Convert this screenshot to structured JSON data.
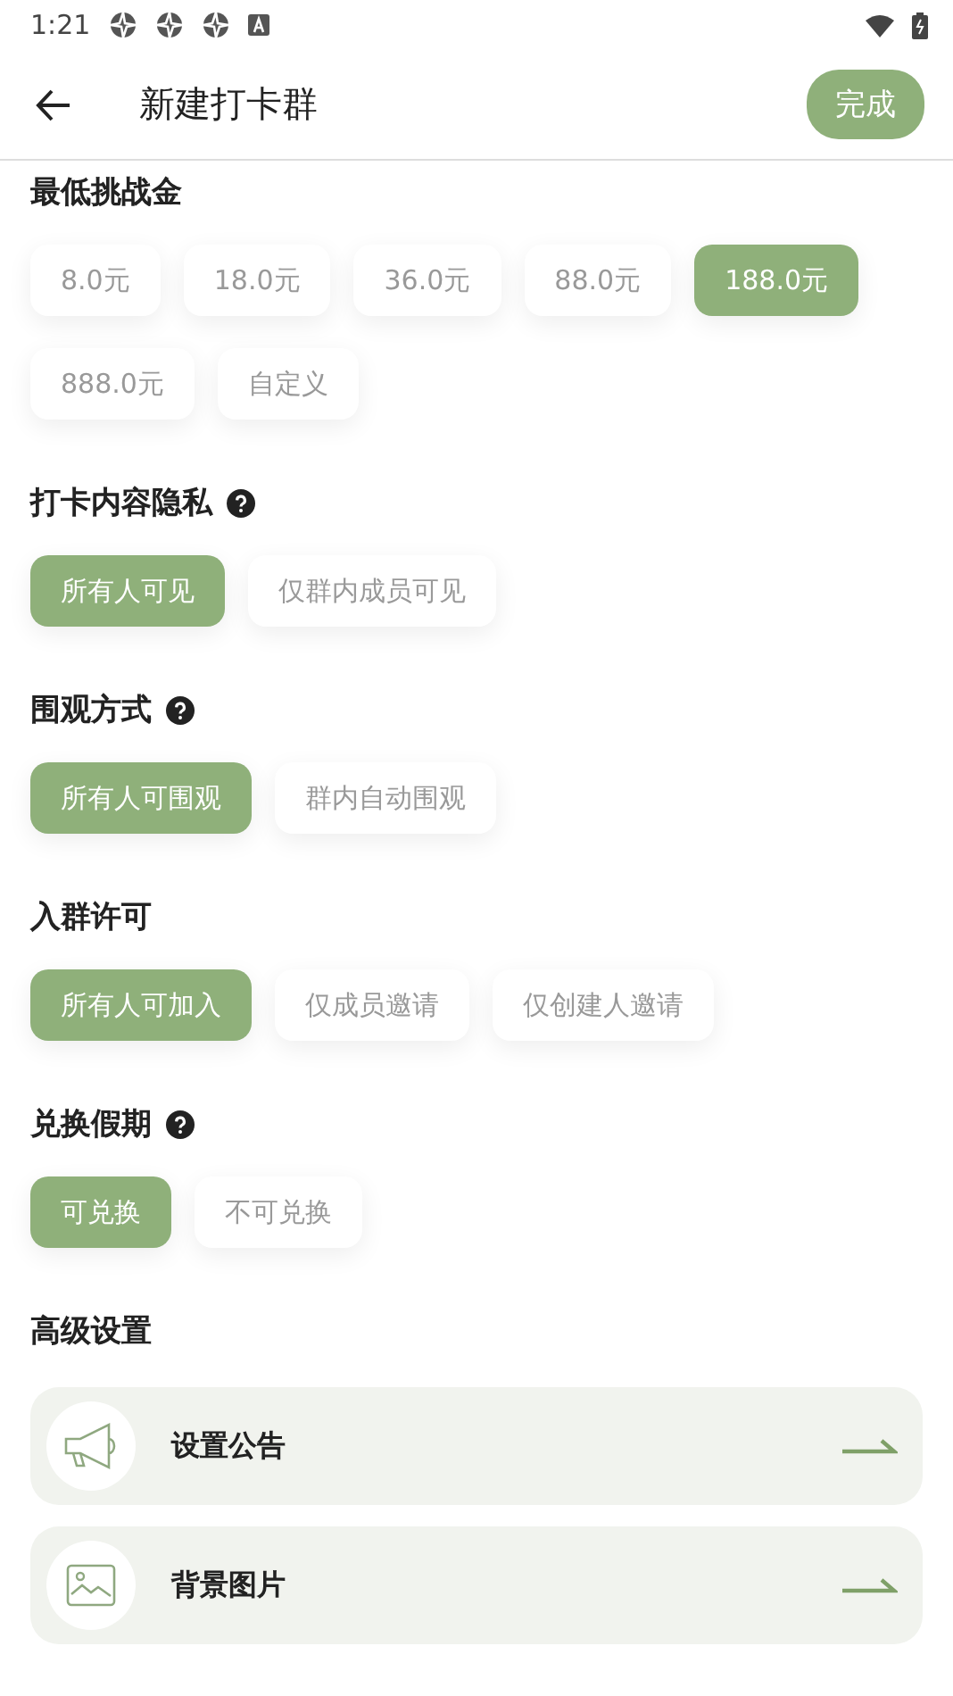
{
  "status_bar": {
    "time": "1:21"
  },
  "header": {
    "title": "新建打卡群",
    "done": "完成"
  },
  "sections": [
    {
      "title": "最低挑战金",
      "help": false,
      "options": [
        {
          "label": "8.0元",
          "selected": false
        },
        {
          "label": "18.0元",
          "selected": false
        },
        {
          "label": "36.0元",
          "selected": false
        },
        {
          "label": "88.0元",
          "selected": false
        },
        {
          "label": "188.0元",
          "selected": true
        },
        {
          "label": "888.0元",
          "selected": false
        },
        {
          "label": "自定义",
          "selected": false
        }
      ]
    },
    {
      "title": "打卡内容隐私",
      "help": true,
      "options": [
        {
          "label": "所有人可见",
          "selected": true
        },
        {
          "label": "仅群内成员可见",
          "selected": false
        }
      ]
    },
    {
      "title": "围观方式",
      "help": true,
      "options": [
        {
          "label": "所有人可围观",
          "selected": true
        },
        {
          "label": "群内自动围观",
          "selected": false
        }
      ]
    },
    {
      "title": "入群许可",
      "help": false,
      "options": [
        {
          "label": "所有人可加入",
          "selected": true
        },
        {
          "label": "仅成员邀请",
          "selected": false
        },
        {
          "label": "仅创建人邀请",
          "selected": false
        }
      ]
    },
    {
      "title": "兑换假期",
      "help": true,
      "options": [
        {
          "label": "可兑换",
          "selected": true
        },
        {
          "label": "不可兑换",
          "selected": false
        }
      ]
    }
  ],
  "advanced": {
    "title": "高级设置",
    "items": [
      {
        "kind": "announcement",
        "label": "设置公告"
      },
      {
        "kind": "background",
        "label": "背景图片"
      }
    ]
  }
}
